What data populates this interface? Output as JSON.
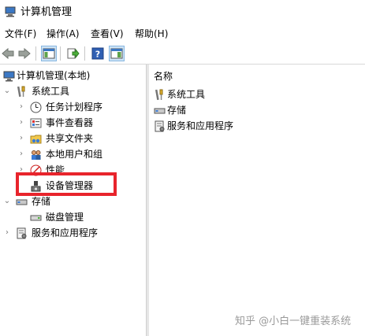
{
  "window": {
    "title": "计算机管理"
  },
  "menu": [
    "文件(F)",
    "操作(A)",
    "查看(V)",
    "帮助(H)"
  ],
  "toolbar": {
    "buttons": [
      "back-icon",
      "forward-icon",
      "show-hide-console-tree-icon",
      "export-list-icon",
      "help-icon",
      "action-pane-icon"
    ]
  },
  "tree": {
    "root": "计算机管理(本地)",
    "system_tools": "系统工具",
    "task_scheduler": "任务计划程序",
    "event_viewer": "事件查看器",
    "shared_folders": "共享文件夹",
    "local_users_groups": "本地用户和组",
    "performance": "性能",
    "device_manager": "设备管理器",
    "storage": "存储",
    "disk_management": "磁盘管理",
    "services_apps": "服务和应用程序"
  },
  "list": {
    "column_header": "名称",
    "items": [
      "系统工具",
      "存储",
      "服务和应用程序"
    ]
  },
  "highlight": {
    "color": "#e8242c"
  },
  "watermark": "知乎 @小白一键重装系统"
}
